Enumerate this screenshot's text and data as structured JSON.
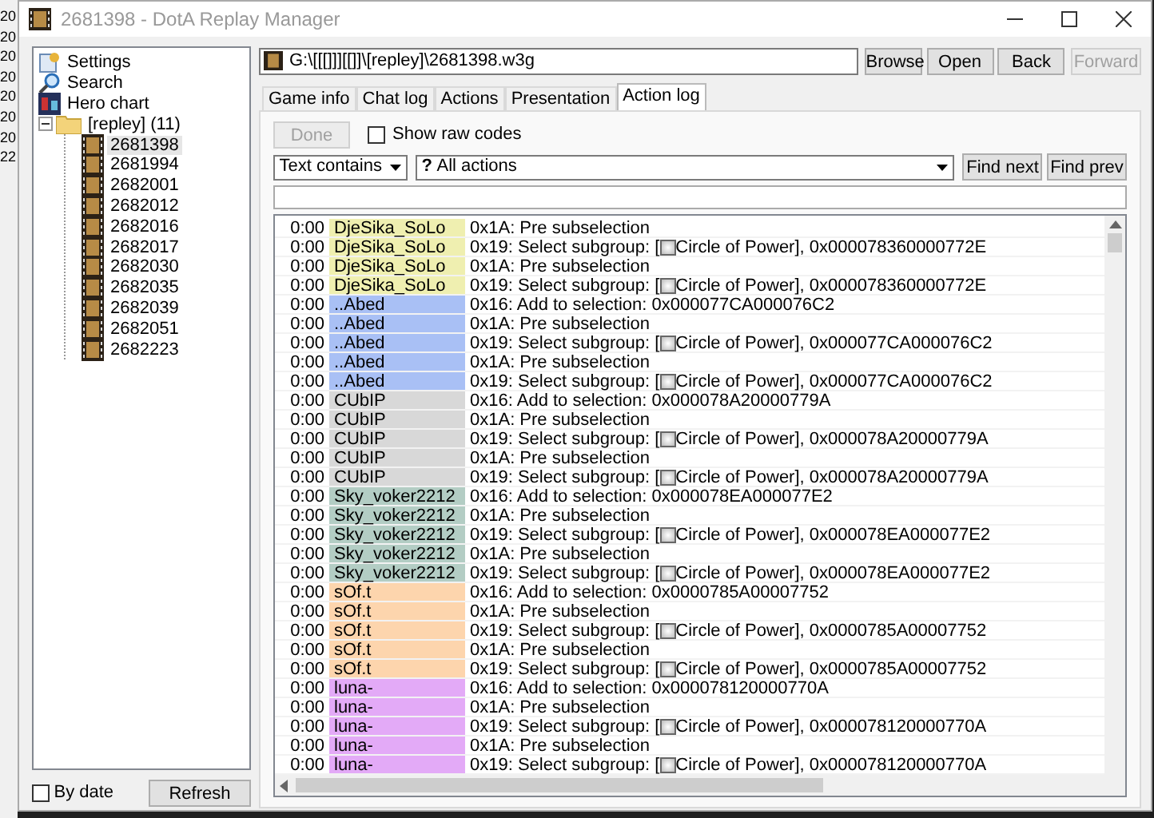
{
  "background_window": {
    "fragments": [
      "20",
      "20",
      "20",
      "20",
      "20",
      "20",
      "20",
      "22"
    ]
  },
  "window": {
    "title": "2681398 - DotA Replay Manager"
  },
  "sidebar": {
    "tree": [
      {
        "kind": "settings",
        "label": "Settings"
      },
      {
        "kind": "search",
        "label": "Search"
      },
      {
        "kind": "chart",
        "label": "Hero chart"
      },
      {
        "kind": "folder",
        "label": "[repley] (11)",
        "expanded": true,
        "children": [
          {
            "kind": "replay",
            "label": "2681398",
            "selected": true
          },
          {
            "kind": "replay",
            "label": "2681994",
            "selected": false
          },
          {
            "kind": "replay",
            "label": "2682001",
            "selected": false
          },
          {
            "kind": "replay",
            "label": "2682012",
            "selected": false
          },
          {
            "kind": "replay",
            "label": "2682016",
            "selected": false
          },
          {
            "kind": "replay",
            "label": "2682017",
            "selected": false
          },
          {
            "kind": "replay",
            "label": "2682030",
            "selected": false
          },
          {
            "kind": "replay",
            "label": "2682035",
            "selected": false
          },
          {
            "kind": "replay",
            "label": "2682039",
            "selected": false
          },
          {
            "kind": "replay",
            "label": "2682051",
            "selected": false
          },
          {
            "kind": "replay",
            "label": "2682223",
            "selected": false
          }
        ]
      }
    ],
    "by_date": {
      "label": "By date",
      "checked": false
    },
    "refresh_button": "Refresh"
  },
  "path": {
    "value": "G:\\[[[]]][[]]\\[repley]\\2681398.w3g"
  },
  "toolbar_buttons": [
    {
      "label": "Browse",
      "disabled": false
    },
    {
      "label": "Open",
      "disabled": false
    },
    {
      "label": "Back",
      "disabled": false
    },
    {
      "label": "Forward",
      "disabled": true
    }
  ],
  "tabs": [
    {
      "label": "Game info",
      "selected": false
    },
    {
      "label": "Chat log",
      "selected": false
    },
    {
      "label": "Actions",
      "selected": false
    },
    {
      "label": "Presentation",
      "selected": false
    },
    {
      "label": "Action log",
      "selected": true
    }
  ],
  "done_button": {
    "label": "Done",
    "disabled": true
  },
  "raw_codes": {
    "label": "Show raw codes",
    "checked": false
  },
  "filter_mode": "Text contains",
  "action_filter": {
    "icon": "?",
    "value": "All actions"
  },
  "find_buttons": [
    "Find next",
    "Find prev"
  ],
  "log_rows": [
    {
      "time": "0:00",
      "player": "DjeSika_SoLo",
      "color": "#efefb0",
      "kind": "plain",
      "action": "0x1A: Pre subselection"
    },
    {
      "time": "0:00",
      "player": "DjeSika_SoLo",
      "color": "#efefb0",
      "kind": "subgroup",
      "action": "0x19: Select subgroup: [",
      "unit": "Circle of Power], 0x000078360000772E"
    },
    {
      "time": "0:00",
      "player": "DjeSika_SoLo",
      "color": "#efefb0",
      "kind": "plain",
      "action": "0x1A: Pre subselection"
    },
    {
      "time": "0:00",
      "player": "DjeSika_SoLo",
      "color": "#efefb0",
      "kind": "subgroup",
      "action": "0x19: Select subgroup: [",
      "unit": "Circle of Power], 0x000078360000772E"
    },
    {
      "time": "0:00",
      "player": "..Abed",
      "color": "#a9c0f5",
      "kind": "plain",
      "action": "0x16: Add to selection: 0x000077CA000076C2"
    },
    {
      "time": "0:00",
      "player": "..Abed",
      "color": "#a9c0f5",
      "kind": "plain",
      "action": "0x1A: Pre subselection"
    },
    {
      "time": "0:00",
      "player": "..Abed",
      "color": "#a9c0f5",
      "kind": "subgroup",
      "action": "0x19: Select subgroup: [",
      "unit": "Circle of Power], 0x000077CA000076C2"
    },
    {
      "time": "0:00",
      "player": "..Abed",
      "color": "#a9c0f5",
      "kind": "plain",
      "action": "0x1A: Pre subselection"
    },
    {
      "time": "0:00",
      "player": "..Abed",
      "color": "#a9c0f5",
      "kind": "subgroup",
      "action": "0x19: Select subgroup: [",
      "unit": "Circle of Power], 0x000077CA000076C2"
    },
    {
      "time": "0:00",
      "player": "CUbIP",
      "color": "#d8d8d8",
      "kind": "plain",
      "action": "0x16: Add to selection: 0x000078A20000779A"
    },
    {
      "time": "0:00",
      "player": "CUbIP",
      "color": "#d8d8d8",
      "kind": "plain",
      "action": "0x1A: Pre subselection"
    },
    {
      "time": "0:00",
      "player": "CUbIP",
      "color": "#d8d8d8",
      "kind": "subgroup",
      "action": "0x19: Select subgroup: [",
      "unit": "Circle of Power], 0x000078A20000779A"
    },
    {
      "time": "0:00",
      "player": "CUbIP",
      "color": "#d8d8d8",
      "kind": "plain",
      "action": "0x1A: Pre subselection"
    },
    {
      "time": "0:00",
      "player": "CUbIP",
      "color": "#d8d8d8",
      "kind": "subgroup",
      "action": "0x19: Select subgroup: [",
      "unit": "Circle of Power], 0x000078A20000779A"
    },
    {
      "time": "0:00",
      "player": "Sky_voker2212",
      "color": "#b3cdc4",
      "kind": "plain",
      "action": "0x16: Add to selection: 0x000078EA000077E2"
    },
    {
      "time": "0:00",
      "player": "Sky_voker2212",
      "color": "#b3cdc4",
      "kind": "plain",
      "action": "0x1A: Pre subselection"
    },
    {
      "time": "0:00",
      "player": "Sky_voker2212",
      "color": "#b3cdc4",
      "kind": "subgroup",
      "action": "0x19: Select subgroup: [",
      "unit": "Circle of Power], 0x000078EA000077E2"
    },
    {
      "time": "0:00",
      "player": "Sky_voker2212",
      "color": "#b3cdc4",
      "kind": "plain",
      "action": "0x1A: Pre subselection"
    },
    {
      "time": "0:00",
      "player": "Sky_voker2212",
      "color": "#b3cdc4",
      "kind": "subgroup",
      "action": "0x19: Select subgroup: [",
      "unit": "Circle of Power], 0x000078EA000077E2"
    },
    {
      "time": "0:00",
      "player": "sOf.t",
      "color": "#fdd5ad",
      "kind": "plain",
      "action": "0x16: Add to selection: 0x0000785A00007752"
    },
    {
      "time": "0:00",
      "player": "sOf.t",
      "color": "#fdd5ad",
      "kind": "plain",
      "action": "0x1A: Pre subselection"
    },
    {
      "time": "0:00",
      "player": "sOf.t",
      "color": "#fdd5ad",
      "kind": "subgroup",
      "action": "0x19: Select subgroup: [",
      "unit": "Circle of Power], 0x0000785A00007752"
    },
    {
      "time": "0:00",
      "player": "sOf.t",
      "color": "#fdd5ad",
      "kind": "plain",
      "action": "0x1A: Pre subselection"
    },
    {
      "time": "0:00",
      "player": "sOf.t",
      "color": "#fdd5ad",
      "kind": "subgroup",
      "action": "0x19: Select subgroup: [",
      "unit": "Circle of Power], 0x0000785A00007752"
    },
    {
      "time": "0:00",
      "player": "luna-",
      "color": "#e3aaf7",
      "kind": "plain",
      "action": "0x16: Add to selection: 0x000078120000770A"
    },
    {
      "time": "0:00",
      "player": "luna-",
      "color": "#e3aaf7",
      "kind": "plain",
      "action": "0x1A: Pre subselection"
    },
    {
      "time": "0:00",
      "player": "luna-",
      "color": "#e3aaf7",
      "kind": "subgroup",
      "action": "0x19: Select subgroup: [",
      "unit": "Circle of Power], 0x000078120000770A"
    },
    {
      "time": "0:00",
      "player": "luna-",
      "color": "#e3aaf7",
      "kind": "plain",
      "action": "0x1A: Pre subselection"
    },
    {
      "time": "0:00",
      "player": "luna-",
      "color": "#e3aaf7",
      "kind": "subgroup",
      "action": "0x19: Select subgroup: [",
      "unit": "Circle of Power], 0x000078120000770A"
    }
  ]
}
